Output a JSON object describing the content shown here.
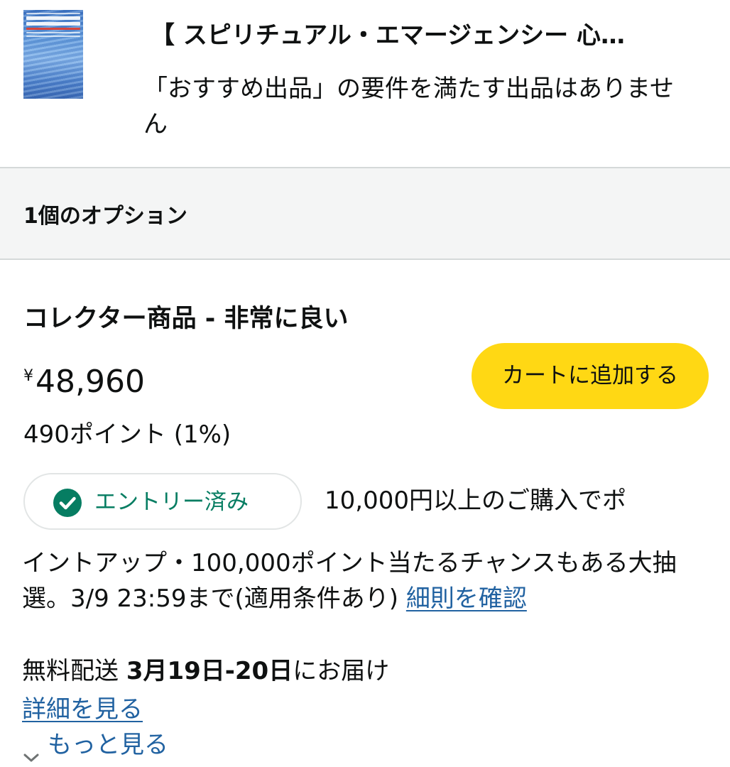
{
  "header": {
    "product_title": "【 スピリチュアル・エマージェンシー 心…",
    "featured_note": "「おすすめ出品」の要件を満たす出品はありません"
  },
  "options": {
    "count_label": "1個のオプション"
  },
  "offer": {
    "condition": "コレクター商品 - 非常に良い",
    "currency_symbol": "¥",
    "price": "48,960",
    "cart_button_label": "カートに追加する",
    "points": "490ポイント (1%)",
    "entry_badge_label": "エントリー済み",
    "promo_first_line": "10,000円以上のご購入でポ",
    "promo_rest": "イントアップ・100,000ポイント当たるチャンスもある大抽選。3/9 23:59まで(適用条件あり)",
    "promo_link_label": "細則を確認",
    "delivery_prefix": "無料配送",
    "delivery_date": "3月19日-20日",
    "delivery_suffix": "にお届け",
    "details_link_label": "詳細を見る",
    "more_label": "もっと見る"
  },
  "colors": {
    "cart_button": "#ffd814",
    "link": "#2162a1",
    "entry_green": "#067d62",
    "options_bar_bg": "#f4f5f5"
  },
  "icons": [
    "check-circle-icon",
    "chevron-down-icon"
  ]
}
